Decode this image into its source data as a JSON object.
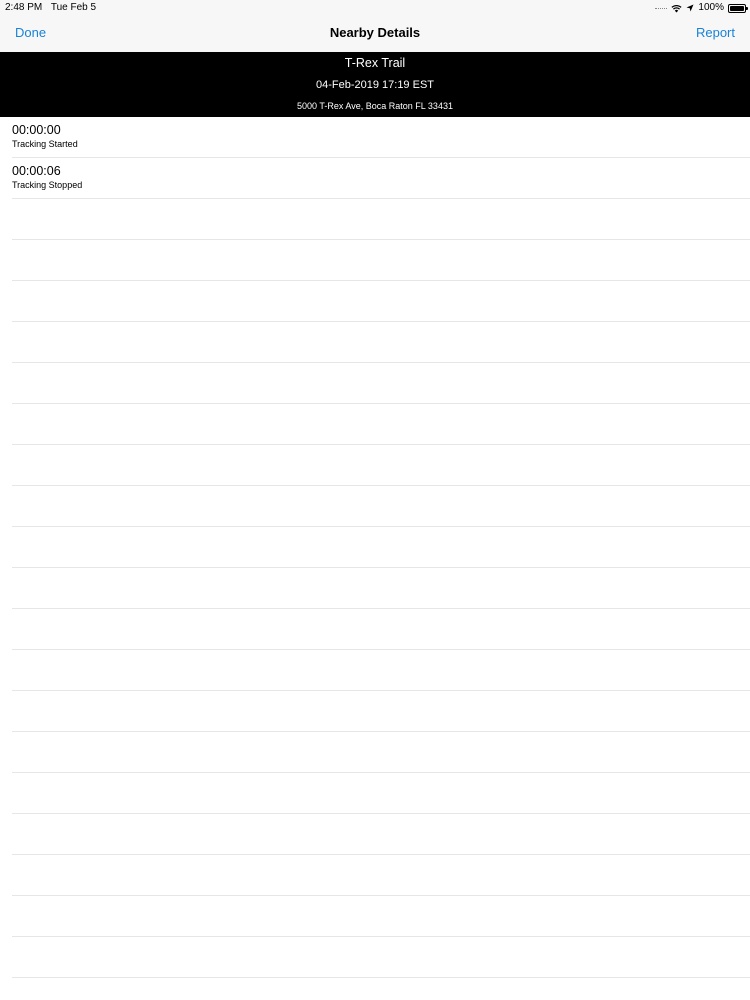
{
  "status_bar": {
    "time": "2:48 PM",
    "date": "Tue Feb 5",
    "battery": "100%",
    "icons": [
      "signal-dots-icon",
      "wifi-icon",
      "location-arrow-icon",
      "battery-icon"
    ]
  },
  "nav": {
    "left_button": "Done",
    "title": "Nearby Details",
    "right_button": "Report",
    "accent_color": "#1a82d6"
  },
  "header": {
    "name": "T-Rex Trail",
    "datetime": "04-Feb-2019 17:19 EST",
    "address": "5000 T-Rex Ave, Boca Raton FL 33431"
  },
  "events": [
    {
      "time": "00:00:00",
      "label": "Tracking Started"
    },
    {
      "time": "00:00:06",
      "label": "Tracking Stopped"
    }
  ],
  "empty_rows": 19
}
